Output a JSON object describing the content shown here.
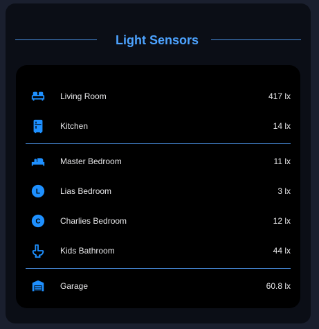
{
  "card": {
    "title": "Light Sensors",
    "accent_color": "#4da3ff"
  },
  "sensors": [
    {
      "name": "Living Room",
      "value": "417 lx",
      "icon": "sofa-icon"
    },
    {
      "name": "Kitchen",
      "value": "14 lx",
      "icon": "fridge-icon"
    },
    {
      "name": "Master Bedroom",
      "value": "11 lx",
      "icon": "bed-icon"
    },
    {
      "name": "Lias Bedroom",
      "value": "3 lx",
      "icon": "letter-l-circle-icon",
      "icon_letter": "L"
    },
    {
      "name": "Charlies Bedroom",
      "value": "12 lx",
      "icon": "letter-c-circle-icon",
      "icon_letter": "C"
    },
    {
      "name": "Kids Bathroom",
      "value": "44 lx",
      "icon": "toilet-icon"
    },
    {
      "name": "Garage",
      "value": "60.8 lx",
      "icon": "garage-icon"
    }
  ]
}
